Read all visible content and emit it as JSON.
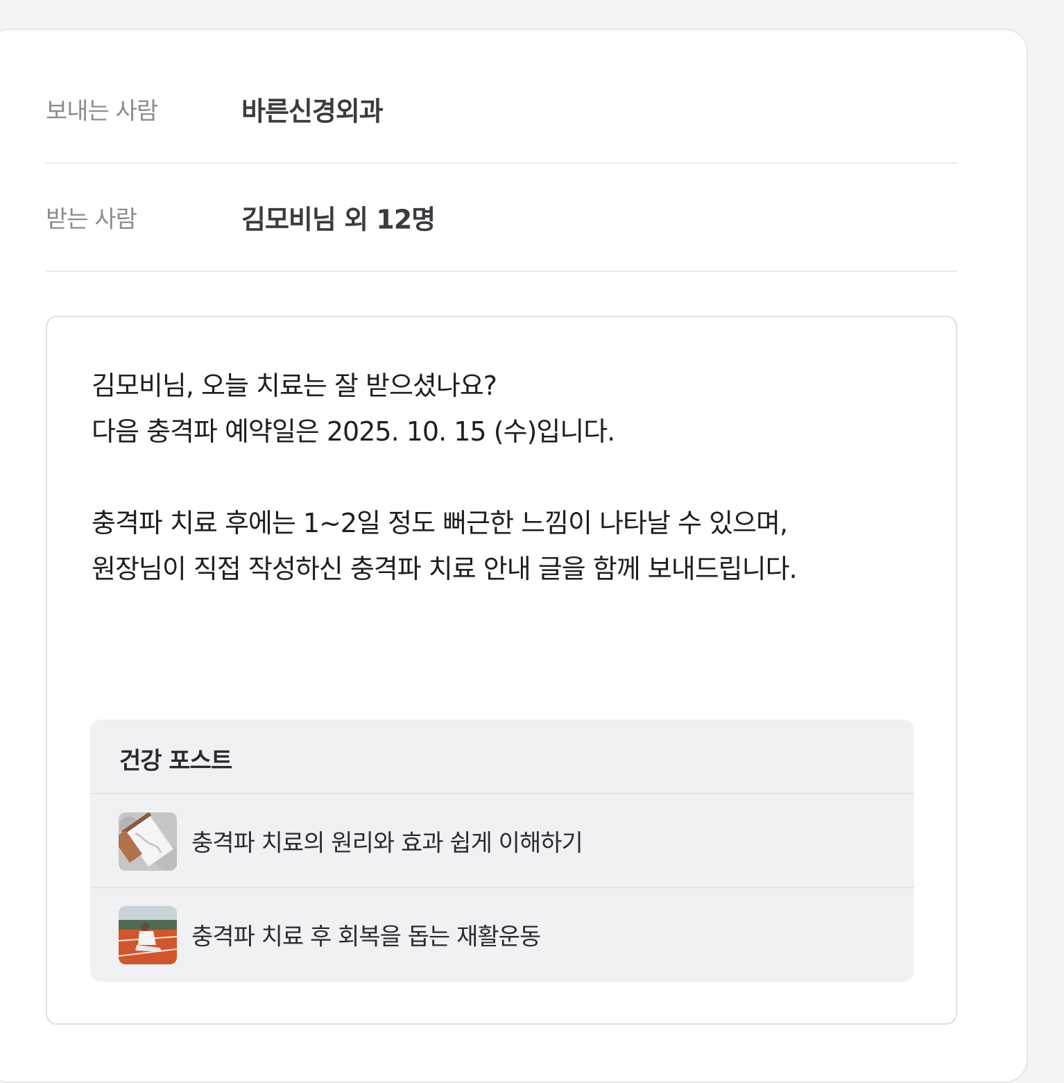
{
  "header": {
    "sender_label": "보내는 사람",
    "sender_value": "바른신경외과",
    "receiver_label": "받는 사람",
    "receiver_value": "김모비님 외 12명"
  },
  "message": {
    "line1": "김모비님, 오늘 치료는 잘 받으셨나요?",
    "line2": "다음 충격파 예약일은 2025. 10. 15 (수)입니다.",
    "line3": "충격파 치료 후에는 1~2일 정도 뻐근한 느낌이 나타날 수 있으며,",
    "line4": "원장님이 직접 작성하신 충격파 치료 안내 글을 함께 보내드립니다."
  },
  "health_posts": {
    "title": "건강 포스트",
    "items": [
      {
        "label": "충격파 치료의 원리와 효과 쉽게 이해하기",
        "thumbnail": "clipboard-anatomy-image"
      },
      {
        "label": "충격파 치료 후 회복을 돕는 재활운동",
        "thumbnail": "runner-stretching-image"
      }
    ]
  }
}
